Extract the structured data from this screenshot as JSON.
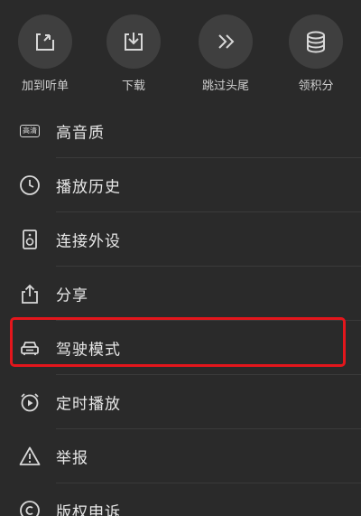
{
  "actions": [
    {
      "label": "加到听单",
      "icon": "add-to-list-icon"
    },
    {
      "label": "下载",
      "icon": "download-icon"
    },
    {
      "label": "跳过头尾",
      "icon": "skip-intro-outro-icon"
    },
    {
      "label": "领积分",
      "icon": "coins-icon"
    }
  ],
  "menu": {
    "items": [
      {
        "label": "高音质",
        "icon": "hq-badge-icon",
        "badge": "高清"
      },
      {
        "label": "播放历史",
        "icon": "clock-icon"
      },
      {
        "label": "连接外设",
        "icon": "speaker-icon"
      },
      {
        "label": "分享",
        "icon": "share-icon"
      },
      {
        "label": "驾驶模式",
        "icon": "car-icon",
        "highlighted": true
      },
      {
        "label": "定时播放",
        "icon": "alarm-play-icon"
      },
      {
        "label": "举报",
        "icon": "warning-icon"
      },
      {
        "label": "版权申诉",
        "icon": "copyright-icon"
      }
    ]
  },
  "colors": {
    "background": "#2a2a2a",
    "highlight": "#e3161c",
    "text": "#e8e8e8"
  }
}
